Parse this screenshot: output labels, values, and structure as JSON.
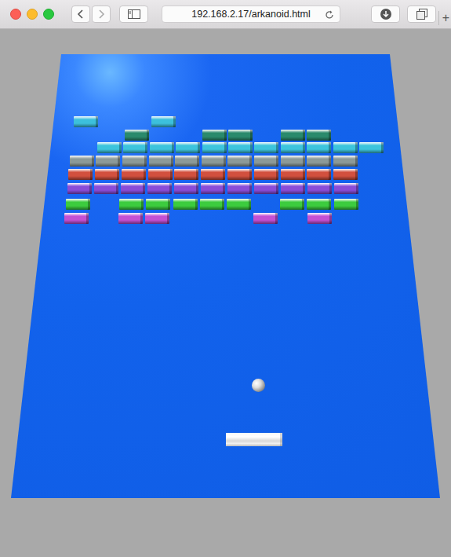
{
  "browser": {
    "url": "192.168.2.17/arkanoid.html",
    "new_tab": "+"
  },
  "game": {
    "brick_rows": [
      {
        "color": "#3cc0dc",
        "bricks": [
          true,
          false,
          false,
          true,
          false,
          false,
          false,
          false,
          false,
          false,
          false,
          false
        ]
      },
      {
        "color": "#2a8a6c",
        "bricks": [
          false,
          false,
          true,
          false,
          false,
          true,
          true,
          false,
          true,
          true,
          false,
          false
        ]
      },
      {
        "color": "#3cc4dc",
        "bricks": [
          false,
          true,
          true,
          true,
          true,
          true,
          true,
          true,
          true,
          true,
          true,
          true
        ]
      },
      {
        "color": "#8c9a98",
        "bricks": [
          true,
          true,
          true,
          true,
          true,
          true,
          true,
          true,
          true,
          true,
          true,
          false
        ]
      },
      {
        "color": "#d2503e",
        "bricks": [
          true,
          true,
          true,
          true,
          true,
          true,
          true,
          true,
          true,
          true,
          true,
          false
        ]
      },
      {
        "color": "#8a4cd8",
        "bricks": [
          true,
          true,
          true,
          true,
          true,
          true,
          true,
          true,
          true,
          true,
          true,
          false
        ]
      },
      {
        "color": "#3ccc3e",
        "bricks": [
          true,
          false,
          true,
          true,
          true,
          true,
          true,
          false,
          true,
          true,
          true,
          false
        ]
      },
      {
        "color": "#c450d4",
        "bricks": [
          true,
          false,
          true,
          true,
          false,
          false,
          false,
          true,
          false,
          true,
          false,
          false
        ]
      }
    ]
  }
}
